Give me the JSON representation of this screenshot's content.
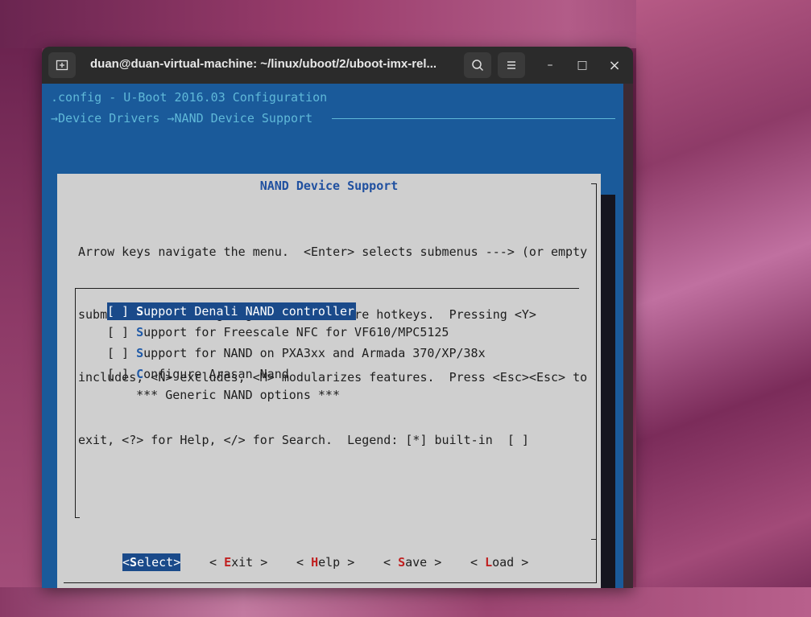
{
  "window": {
    "title": "duan@duan-virtual-machine: ~/linux/uboot/2/uboot-imx-rel...",
    "new_tab_icon": "new-tab-icon",
    "search_icon": "search-icon",
    "menu_icon": "hamburger-menu-icon",
    "minimize": "–",
    "maximize": "□",
    "close": "×"
  },
  "terminal": {
    "header_config": ".config - U-Boot 2016.03 Configuration",
    "breadcrumb": "→Device Drivers →NAND Device Support"
  },
  "dialog": {
    "title": "NAND Device Support",
    "help_lines": [
      "Arrow keys navigate the menu.  <Enter> selects submenus ---> (or empty",
      "submenus ----).  Highlighted letters are hotkeys.  Pressing <Y>",
      "includes, <N> excludes, <M> modularizes features.  Press <Esc><Esc> to",
      "exit, <?> for Help, </> for Search.  Legend: [*] built-in  [ ]"
    ],
    "items": [
      {
        "box": "[ ]",
        "hot": "S",
        "rest": "upport Denali NAND controller",
        "selected": true
      },
      {
        "box": "[ ]",
        "hot": "S",
        "rest": "upport for Freescale NFC for VF610/MPC5125",
        "selected": false
      },
      {
        "box": "[ ]",
        "hot": "S",
        "rest": "upport for NAND on PXA3xx and Armada 370/XP/38x",
        "selected": false
      },
      {
        "box": "[ ]",
        "hot": "C",
        "rest": "onfigure Arasan Nand",
        "selected": false
      },
      {
        "box": "",
        "hot": "",
        "rest": "    *** Generic NAND options ***",
        "selected": false
      }
    ],
    "buttons": [
      {
        "pre": "<",
        "key": "S",
        "post": "elect>",
        "selected": true
      },
      {
        "pre": "< ",
        "key": "E",
        "post": "xit >",
        "selected": false
      },
      {
        "pre": "< ",
        "key": "H",
        "post": "elp >",
        "selected": false
      },
      {
        "pre": "< ",
        "key": "S",
        "post": "ave >",
        "selected": false
      },
      {
        "pre": "< ",
        "key": "L",
        "post": "oad >",
        "selected": false
      }
    ]
  }
}
